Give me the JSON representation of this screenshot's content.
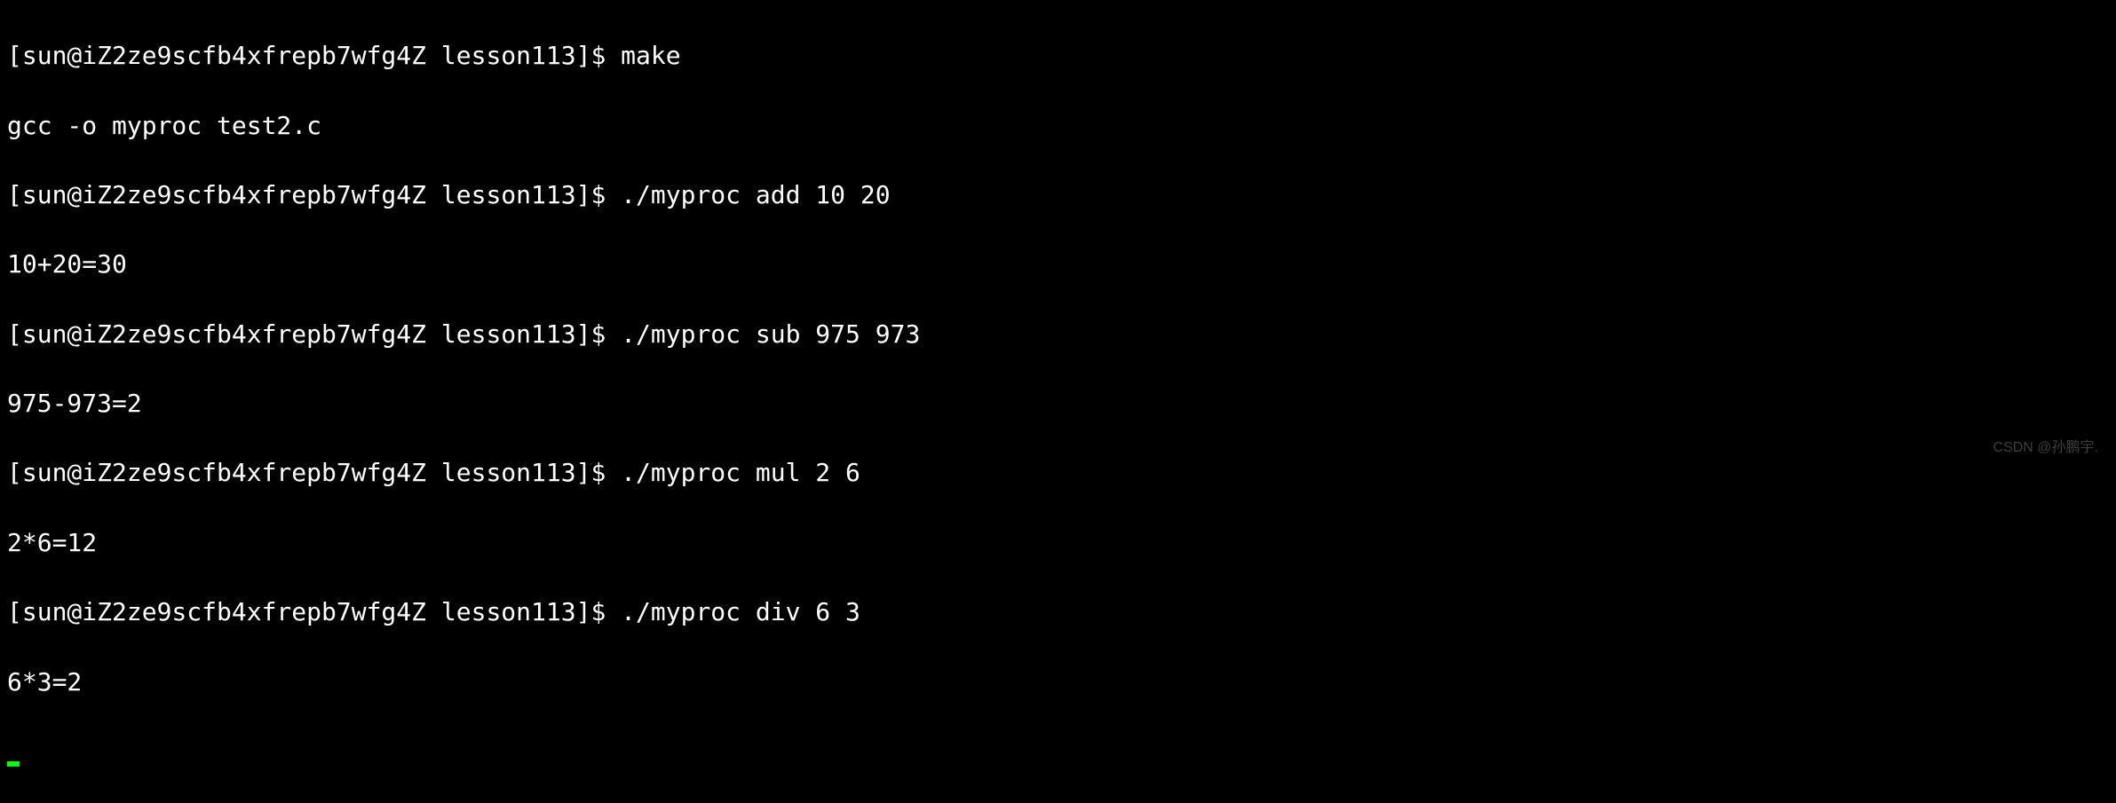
{
  "terminal": {
    "lines": [
      {
        "prompt": "[sun@iZ2ze9scfb4xfrepb7wfg4Z lesson113]$ ",
        "command": "make"
      },
      {
        "output": "gcc -o myproc test2.c"
      },
      {
        "prompt": "[sun@iZ2ze9scfb4xfrepb7wfg4Z lesson113]$ ",
        "command": "./myproc add 10 20"
      },
      {
        "output": "10+20=30"
      },
      {
        "prompt": "[sun@iZ2ze9scfb4xfrepb7wfg4Z lesson113]$ ",
        "command": "./myproc sub 975 973"
      },
      {
        "output": "975-973=2"
      },
      {
        "prompt": "[sun@iZ2ze9scfb4xfrepb7wfg4Z lesson113]$ ",
        "command": "./myproc mul 2 6"
      },
      {
        "output": "2*6=12"
      },
      {
        "prompt": "[sun@iZ2ze9scfb4xfrepb7wfg4Z lesson113]$ ",
        "command": "./myproc div 6 3"
      },
      {
        "output": "6*3=2"
      }
    ]
  },
  "watermark": "CSDN @孙鹏宇."
}
